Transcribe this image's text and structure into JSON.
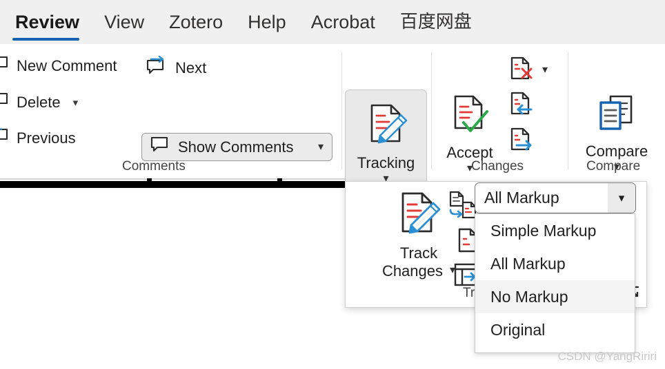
{
  "app": {
    "watermark": "CSDN @YangRiriri"
  },
  "tabs": [
    {
      "label": "Review",
      "active": true,
      "name": "tab-review"
    },
    {
      "label": "View",
      "active": false,
      "name": "tab-view"
    },
    {
      "label": "Zotero",
      "active": false,
      "name": "tab-zotero"
    },
    {
      "label": "Help",
      "active": false,
      "name": "tab-help"
    },
    {
      "label": "Acrobat",
      "active": false,
      "name": "tab-acrobat"
    },
    {
      "label": "百度网盘",
      "active": false,
      "name": "tab-baidu-netdisk"
    }
  ],
  "ribbon": {
    "groups": {
      "comments": {
        "label": "Comments",
        "new_comment": "New Comment",
        "delete": "Delete",
        "previous": "Previous",
        "next": "Next",
        "show_comments": "Show Comments"
      },
      "tracking": {
        "label": "Tracking",
        "button_label": "Tracking"
      },
      "changes": {
        "label": "Changes",
        "accept": "Accept",
        "reject": "Reject",
        "previous": "Previous Change",
        "next": "Next Change"
      },
      "compare": {
        "label": "Compare",
        "button_label": "Compare"
      }
    },
    "icons": {
      "new_comment": "comment-bubble-icon",
      "delete_comment": "comment-delete-icon",
      "previous_comment": "comment-previous-icon",
      "next_comment": "comment-next-icon",
      "show_comments": "comment-show-icon",
      "tracking": "track-changes-doc-pencil-icon",
      "accept": "accept-change-check-icon",
      "reject": "reject-change-cross-icon",
      "previous_change": "previous-change-arrow-icon",
      "next_change": "next-change-arrow-icon",
      "compare": "compare-documents-icon",
      "chevron_down": "chevron-down-icon"
    }
  },
  "track_popup": {
    "track_changes_label": "Track\nChanges",
    "track_changes_line1": "Track",
    "track_changes_line2": "Changes",
    "group_label_partial": "Tra",
    "icons": {
      "track_changes": "track-changes-doc-pencil-icon",
      "lock_tracking": "lock-tracking-icon",
      "show_markup": "show-markup-doc-icon",
      "reviewing_pane": "reviewing-pane-icon",
      "dialog_launcher": "dialog-launcher-arrow-icon"
    }
  },
  "markup_combo": {
    "name": "display-for-review-combobox",
    "value": "All Markup",
    "expanded": true,
    "options": [
      {
        "label": "Simple Markup",
        "selected": false
      },
      {
        "label": "All Markup",
        "selected": false
      },
      {
        "label": "No Markup",
        "selected": true
      },
      {
        "label": "Original",
        "selected": false
      }
    ]
  },
  "colors": {
    "accent_blue": "#1562b0",
    "icon_blue": "#2b8fd4",
    "markup_red": "#e03b36",
    "accept_green": "#2aa84a",
    "ribbon_bg": "#f0f0f0",
    "highlight_bg": "#f4f4f4"
  }
}
